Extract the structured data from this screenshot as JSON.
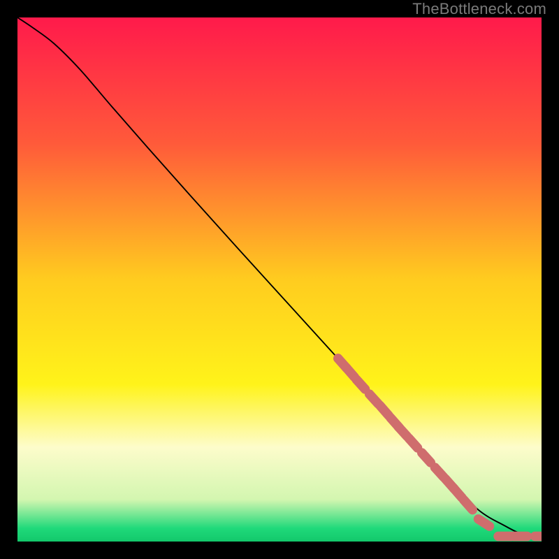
{
  "watermark": "TheBottleneck.com",
  "chart_data": {
    "type": "line",
    "title": "",
    "xlabel": "",
    "ylabel": "",
    "xlim": [
      0,
      100
    ],
    "ylim": [
      0,
      100
    ],
    "grid": false,
    "legend": false,
    "background_gradient_stops": [
      {
        "offset": 0.0,
        "color": "#ff1a4b"
      },
      {
        "offset": 0.24,
        "color": "#ff5a3a"
      },
      {
        "offset": 0.5,
        "color": "#ffcc1f"
      },
      {
        "offset": 0.7,
        "color": "#fff31a"
      },
      {
        "offset": 0.82,
        "color": "#fdfccb"
      },
      {
        "offset": 0.92,
        "color": "#d3f6b0"
      },
      {
        "offset": 0.975,
        "color": "#1fd97a"
      },
      {
        "offset": 1.0,
        "color": "#13c86b"
      }
    ],
    "series": [
      {
        "name": "curve",
        "color": "#000000",
        "x": [
          0,
          3,
          7,
          12,
          18,
          25,
          33,
          42,
          52,
          62,
          72,
          82,
          88,
          93,
          96,
          98,
          100
        ],
        "y": [
          100,
          98,
          95,
          90,
          83,
          75,
          66,
          56,
          45,
          34,
          23,
          12,
          6,
          3,
          1.5,
          1,
          1
        ]
      }
    ],
    "markers": {
      "name": "dashed-points",
      "color": "#cf6d6d",
      "radius_pct": 0.9,
      "x": [
        62,
        63.5,
        65.5,
        68,
        70,
        72,
        73.5,
        75.5,
        78,
        80.5,
        82.5,
        84,
        86,
        89,
        93,
        96,
        100
      ],
      "y": [
        34,
        32.3,
        30,
        27.2,
        25,
        22.7,
        21,
        18.8,
        16,
        13.2,
        11,
        9.3,
        7,
        3.6,
        1,
        1,
        1
      ]
    }
  }
}
